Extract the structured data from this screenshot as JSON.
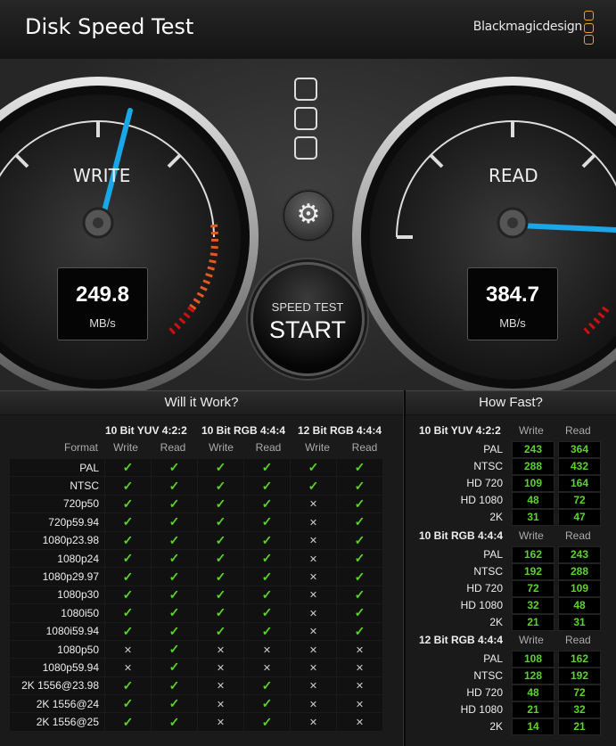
{
  "app": {
    "title": "Disk Speed Test",
    "brand": "Blackmagicdesign"
  },
  "write_gauge": {
    "label": "WRITE",
    "value": "249.8",
    "unit": "MB/s"
  },
  "read_gauge": {
    "label": "READ",
    "value": "384.7",
    "unit": "MB/s"
  },
  "start_button": {
    "line1": "SPEED TEST",
    "line2": "START"
  },
  "settings_icon": "gear-icon",
  "will_it_work": {
    "title": "Will it Work?",
    "format_label": "Format",
    "groups": [
      "10 Bit YUV 4:2:2",
      "10 Bit RGB 4:4:4",
      "12 Bit RGB 4:4:4"
    ],
    "write_label": "Write",
    "read_label": "Read",
    "rows": [
      {
        "format": "PAL",
        "vals": [
          1,
          1,
          1,
          1,
          1,
          1
        ]
      },
      {
        "format": "NTSC",
        "vals": [
          1,
          1,
          1,
          1,
          1,
          1
        ]
      },
      {
        "format": "720p50",
        "vals": [
          1,
          1,
          1,
          1,
          0,
          1
        ]
      },
      {
        "format": "720p59.94",
        "vals": [
          1,
          1,
          1,
          1,
          0,
          1
        ]
      },
      {
        "format": "1080p23.98",
        "vals": [
          1,
          1,
          1,
          1,
          0,
          1
        ]
      },
      {
        "format": "1080p24",
        "vals": [
          1,
          1,
          1,
          1,
          0,
          1
        ]
      },
      {
        "format": "1080p29.97",
        "vals": [
          1,
          1,
          1,
          1,
          0,
          1
        ]
      },
      {
        "format": "1080p30",
        "vals": [
          1,
          1,
          1,
          1,
          0,
          1
        ]
      },
      {
        "format": "1080i50",
        "vals": [
          1,
          1,
          1,
          1,
          0,
          1
        ]
      },
      {
        "format": "1080i59.94",
        "vals": [
          1,
          1,
          1,
          1,
          0,
          1
        ]
      },
      {
        "format": "1080p50",
        "vals": [
          0,
          1,
          0,
          0,
          0,
          0
        ]
      },
      {
        "format": "1080p59.94",
        "vals": [
          0,
          1,
          0,
          0,
          0,
          0
        ]
      },
      {
        "format": "2K 1556@23.98",
        "vals": [
          1,
          1,
          0,
          1,
          0,
          0
        ]
      },
      {
        "format": "2K 1556@24",
        "vals": [
          1,
          1,
          0,
          1,
          0,
          0
        ]
      },
      {
        "format": "2K 1556@25",
        "vals": [
          1,
          1,
          0,
          1,
          0,
          0
        ]
      }
    ]
  },
  "how_fast": {
    "title": "How Fast?",
    "write_label": "Write",
    "read_label": "Read",
    "groups": [
      {
        "name": "10 Bit YUV 4:2:2",
        "rows": [
          {
            "label": "PAL",
            "write": "243",
            "read": "364"
          },
          {
            "label": "NTSC",
            "write": "288",
            "read": "432"
          },
          {
            "label": "HD 720",
            "write": "109",
            "read": "164"
          },
          {
            "label": "HD 1080",
            "write": "48",
            "read": "72"
          },
          {
            "label": "2K",
            "write": "31",
            "read": "47"
          }
        ]
      },
      {
        "name": "10 Bit RGB 4:4:4",
        "rows": [
          {
            "label": "PAL",
            "write": "162",
            "read": "243"
          },
          {
            "label": "NTSC",
            "write": "192",
            "read": "288"
          },
          {
            "label": "HD 720",
            "write": "72",
            "read": "109"
          },
          {
            "label": "HD 1080",
            "write": "32",
            "read": "48"
          },
          {
            "label": "2K",
            "write": "21",
            "read": "31"
          }
        ]
      },
      {
        "name": "12 Bit RGB 4:4:4",
        "rows": [
          {
            "label": "PAL",
            "write": "108",
            "read": "162"
          },
          {
            "label": "NTSC",
            "write": "128",
            "read": "192"
          },
          {
            "label": "HD 720",
            "write": "48",
            "read": "72"
          },
          {
            "label": "HD 1080",
            "write": "21",
            "read": "32"
          },
          {
            "label": "2K",
            "write": "14",
            "read": "21"
          }
        ]
      }
    ]
  }
}
